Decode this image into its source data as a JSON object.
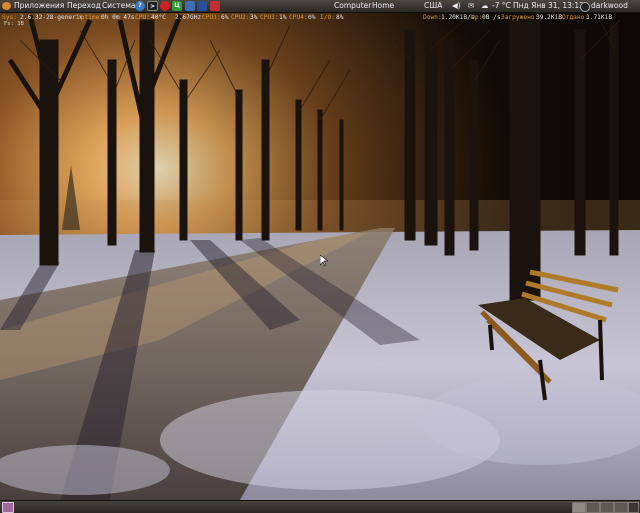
{
  "top_panel": {
    "menus": [
      "Приложения",
      "Переход",
      "Система"
    ],
    "launchers": [
      {
        "icon": "help-icon",
        "glyph": "?",
        "color": "#3a78c8"
      },
      {
        "icon": "terminal-icon",
        "glyph": ">",
        "color": "#202020"
      },
      {
        "icon": "red-circle-app-icon",
        "glyph": "",
        "color": "#cc2222"
      },
      {
        "icon": "green-app-icon",
        "glyph": "Ц",
        "color": "#2e9a3a"
      },
      {
        "icon": "image-app-icon",
        "glyph": "",
        "color": "#3a6fb8"
      },
      {
        "icon": "network-app-icon",
        "glyph": "",
        "color": "#2a4f9a"
      },
      {
        "icon": "bittorrent-app-icon",
        "glyph": "",
        "color": "#c03030"
      }
    ],
    "places": [
      "Computer",
      "Home"
    ],
    "tray": {
      "keyboard_layout": "США",
      "temperature": "-7 °C",
      "datetime": "Пнд Янв 31, 13:12",
      "username": "darkwood"
    }
  },
  "conky": {
    "system_label": "Sys:",
    "system_value": "2.6.32-28-generic",
    "uptime_label": "Uptime:",
    "uptime_value": "0h 0m 47s",
    "cpu_label": "CPU:",
    "cpu_temp": "40°C",
    "freq": "2.67GHz",
    "cpu1_label": "CPU1:",
    "cpu1_value": "6%",
    "cpu2_label": "CPU2:",
    "cpu2_value": "3%",
    "cpu3_label": "CPU3:",
    "cpu3_value": "1%",
    "cpu4_label": "CPU4:",
    "cpu4_value": "0%",
    "io_label": "I/O:",
    "io_value": "8%",
    "down_label": "Down:",
    "down_value": "1.20KiB/s",
    "up_label": "Up:",
    "up_value": "0B /s",
    "loaded_label": "Загружено:",
    "loaded_value": "39.2KiB",
    "sent_label": "Отдано:",
    "sent_value": "1.71KiB",
    "sub_line": "Fs: 3B"
  },
  "colors": {
    "label_accent": "#e09a2a",
    "panel": "#3a3632"
  }
}
